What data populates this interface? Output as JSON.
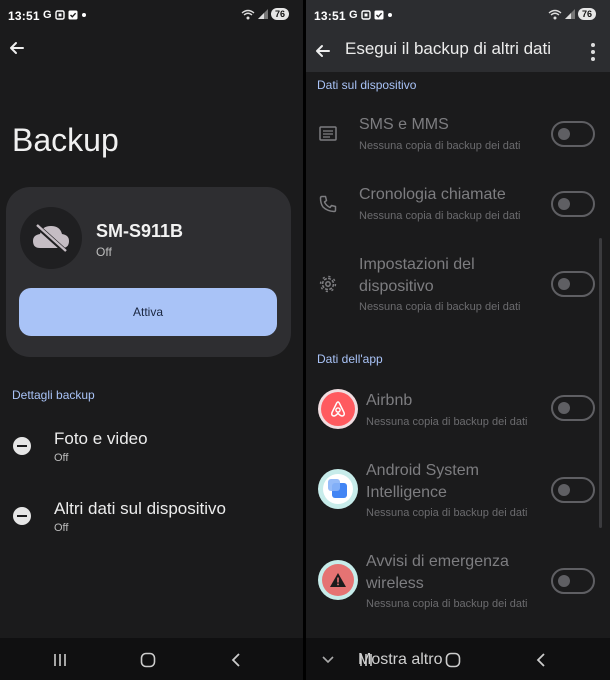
{
  "status_bar": {
    "time": "13:51",
    "carrier_icon": "G",
    "battery": "76"
  },
  "left": {
    "title": "Backup",
    "device": {
      "name": "SM-S911B",
      "status": "Off"
    },
    "activate_label": "Attiva",
    "section_label": "Dettagli backup",
    "items": [
      {
        "title": "Foto e video",
        "status": "Off"
      },
      {
        "title": "Altri dati sul dispositivo",
        "status": "Off"
      }
    ]
  },
  "right": {
    "title": "Esegui il backup di altri dati",
    "section_device": "Dati sul dispositivo",
    "device_items": [
      {
        "title": "SMS e MMS",
        "subtitle": "Nessuna copia di backup dei dati",
        "icon": "message-icon",
        "enabled": false
      },
      {
        "title": "Cronologia chiamate",
        "subtitle": "Nessuna copia di backup dei dati",
        "icon": "phone-icon",
        "enabled": false
      },
      {
        "title_line1": "Impostazioni del",
        "title_line2": "dispositivo",
        "subtitle": "Nessuna copia di backup dei dati",
        "icon": "gear-icon",
        "enabled": false
      }
    ],
    "section_apps": "Dati dell'app",
    "app_items": [
      {
        "title": "Airbnb",
        "subtitle": "Nessuna copia di backup dei dati",
        "icon": "airbnb-icon",
        "enabled": false
      },
      {
        "title_line1": "Android System",
        "title_line2": "Intelligence",
        "subtitle": "Nessuna copia di backup dei dati",
        "icon": "android-system-intelligence-icon",
        "enabled": false
      },
      {
        "title_line1": "Avvisi di emergenza",
        "title_line2": "wireless",
        "subtitle": "Nessuna copia di backup dei dati",
        "icon": "emergency-alert-icon",
        "enabled": false
      }
    ],
    "show_more": "Mostra altro"
  },
  "colors": {
    "accent": "#a9c3f7",
    "background": "#1b1b1c",
    "card": "#2e2e31",
    "airbnb": "#ff5a5f",
    "alert": "#c62828"
  }
}
